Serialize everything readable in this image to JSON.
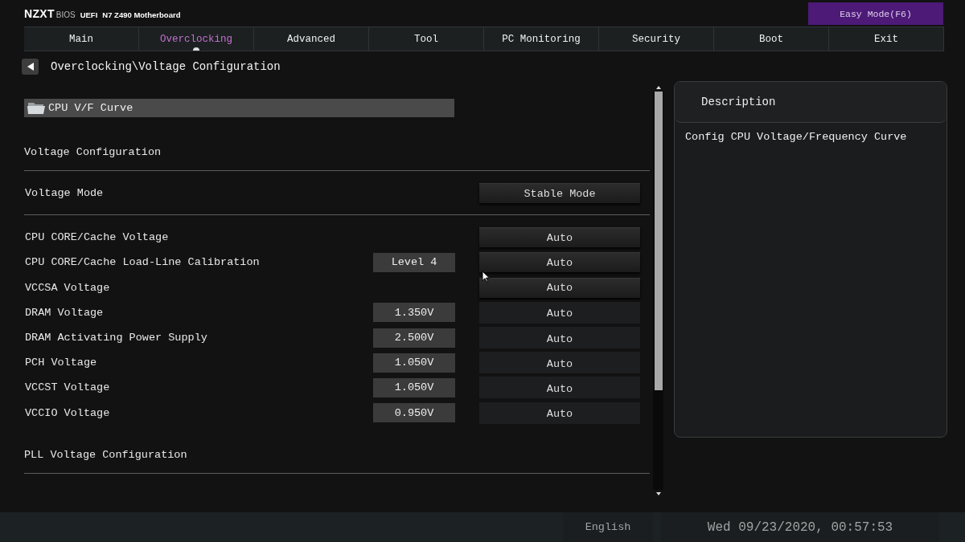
{
  "header": {
    "brand": "NZXT",
    "brand_suffix": "BIOS",
    "firmware": "UEFI",
    "board": "N7 Z490 Motherboard",
    "mode_button": "Easy Mode(F6)"
  },
  "tabs": [
    {
      "label": "Main",
      "selected": false
    },
    {
      "label": "Overclocking",
      "selected": true
    },
    {
      "label": "Advanced",
      "selected": false
    },
    {
      "label": "Tool",
      "selected": false
    },
    {
      "label": "PC Monitoring",
      "selected": false
    },
    {
      "label": "Security",
      "selected": false
    },
    {
      "label": "Boot",
      "selected": false
    },
    {
      "label": "Exit",
      "selected": false
    }
  ],
  "breadcrumb": {
    "path": "Overclocking\\Voltage Configuration"
  },
  "settings": [
    {
      "kind": "folder",
      "label": "CPU V/F Curve",
      "selected": true
    },
    {
      "kind": "heading",
      "label": "Voltage Configuration"
    },
    {
      "kind": "option",
      "label": "Voltage Mode",
      "value": "Stable Mode"
    },
    {
      "kind": "separator"
    },
    {
      "kind": "option",
      "label": "CPU CORE/Cache Voltage",
      "value": "Auto"
    },
    {
      "kind": "option",
      "label": "CPU CORE/Cache Load-Line Calibration",
      "reading": "Level 4",
      "value": "Auto"
    },
    {
      "kind": "option",
      "label": "VCCSA Voltage",
      "value": "Auto"
    },
    {
      "kind": "entry",
      "label": "DRAM Voltage",
      "reading": "1.350V",
      "value": "Auto"
    },
    {
      "kind": "entry",
      "label": "DRAM Activating Power Supply",
      "reading": "2.500V",
      "value": "Auto"
    },
    {
      "kind": "entry",
      "label": "PCH Voltage",
      "reading": "1.050V",
      "value": "Auto"
    },
    {
      "kind": "entry",
      "label": "VCCST Voltage",
      "reading": "1.050V",
      "value": "Auto"
    },
    {
      "kind": "entry",
      "label": "VCCIO Voltage",
      "reading": "0.950V",
      "value": "Auto"
    },
    {
      "kind": "heading",
      "label": "PLL Voltage Configuration"
    }
  ],
  "description": {
    "title": "Description",
    "text": "Config CPU Voltage/Frequency Curve"
  },
  "status_bar": {
    "language": "English",
    "datetime": "Wed 09/23/2020, 00:57:53"
  }
}
